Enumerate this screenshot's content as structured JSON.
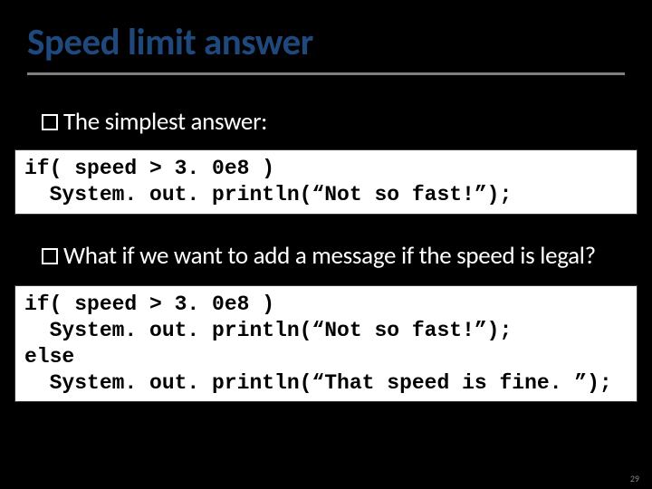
{
  "title": "Speed limit answer",
  "bullets": [
    "The simplest answer:",
    "What if we want to add a message if the speed is legal?"
  ],
  "code_blocks": [
    "if( speed > 3. 0e8 )\n  System. out. println(“Not so fast!”);",
    "if( speed > 3. 0e8 )\n  System. out. println(“Not so fast!”);\nelse\n  System. out. println(“That speed is fine. ”);"
  ],
  "page_number": "29"
}
